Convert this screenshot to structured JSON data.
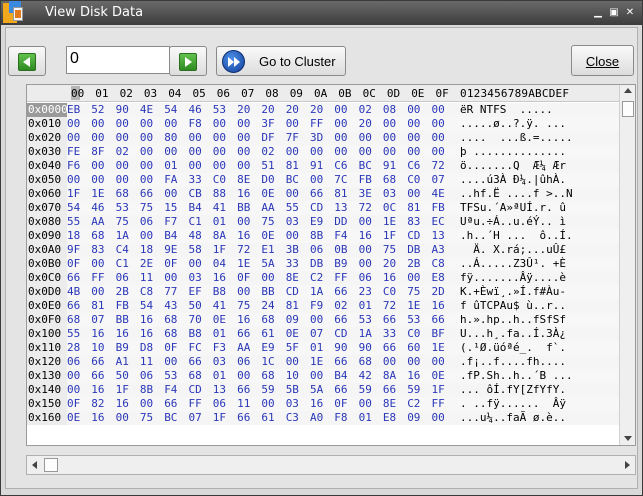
{
  "window": {
    "title": "View Disk Data",
    "icons": [
      "app-icon",
      "minimize-icon",
      "maximize-icon",
      "close-icon"
    ]
  },
  "toolbar": {
    "cluster_value": "0",
    "goto_label": "Go to Cluster",
    "close_label": "Close"
  },
  "hex_view": {
    "columns": [
      "00",
      "01",
      "02",
      "03",
      "04",
      "05",
      "06",
      "07",
      "08",
      "09",
      "0A",
      "0B",
      "0C",
      "0D",
      "0E",
      "0F"
    ],
    "ascii_header": "0123456789ABCDEF",
    "rows": [
      {
        "offset": "0x0000",
        "bytes": [
          "EB",
          "52",
          "90",
          "4E",
          "54",
          "46",
          "53",
          "20",
          "20",
          "20",
          "20",
          "00",
          "02",
          "08",
          "00",
          "00"
        ],
        "ascii": "ëR NTFS  ....."
      },
      {
        "offset": "0x010",
        "bytes": [
          "00",
          "00",
          "00",
          "00",
          "00",
          "F8",
          "00",
          "00",
          "3F",
          "00",
          "FF",
          "00",
          "20",
          "00",
          "00",
          "00"
        ],
        "ascii": ".....ø..?.ÿ. ..."
      },
      {
        "offset": "0x020",
        "bytes": [
          "00",
          "00",
          "00",
          "00",
          "80",
          "00",
          "00",
          "00",
          "DF",
          "7F",
          "3D",
          "00",
          "00",
          "00",
          "00",
          "00"
        ],
        "ascii": "....  ...ß.=....."
      },
      {
        "offset": "0x030",
        "bytes": [
          "FE",
          "8F",
          "02",
          "00",
          "00",
          "00",
          "00",
          "00",
          "02",
          "00",
          "00",
          "00",
          "00",
          "00",
          "00",
          "00"
        ],
        "ascii": "þ .............."
      },
      {
        "offset": "0x040",
        "bytes": [
          "F6",
          "00",
          "00",
          "00",
          "01",
          "00",
          "00",
          "00",
          "51",
          "81",
          "91",
          "C6",
          "BC",
          "91",
          "C6",
          "72"
        ],
        "ascii": "ö.......Q  Æ¼ Ær"
      },
      {
        "offset": "0x050",
        "bytes": [
          "00",
          "00",
          "00",
          "00",
          "FA",
          "33",
          "C0",
          "8E",
          "D0",
          "BC",
          "00",
          "7C",
          "FB",
          "68",
          "C0",
          "07"
        ],
        "ascii": "....ú3À Ð¼.|ûhÀ."
      },
      {
        "offset": "0x060",
        "bytes": [
          "1F",
          "1E",
          "68",
          "66",
          "00",
          "CB",
          "88",
          "16",
          "0E",
          "00",
          "66",
          "81",
          "3E",
          "03",
          "00",
          "4E"
        ],
        "ascii": "..hf.Ë ....f >..N"
      },
      {
        "offset": "0x070",
        "bytes": [
          "54",
          "46",
          "53",
          "75",
          "15",
          "B4",
          "41",
          "BB",
          "AA",
          "55",
          "CD",
          "13",
          "72",
          "0C",
          "81",
          "FB"
        ],
        "ascii": "TFSu.´A»ªUÍ.r. û"
      },
      {
        "offset": "0x080",
        "bytes": [
          "55",
          "AA",
          "75",
          "06",
          "F7",
          "C1",
          "01",
          "00",
          "75",
          "03",
          "E9",
          "DD",
          "00",
          "1E",
          "83",
          "EC"
        ],
        "ascii": "Uªu.÷Á..u.éÝ.. ì"
      },
      {
        "offset": "0x090",
        "bytes": [
          "18",
          "68",
          "1A",
          "00",
          "B4",
          "48",
          "8A",
          "16",
          "0E",
          "00",
          "8B",
          "F4",
          "16",
          "1F",
          "CD",
          "13"
        ],
        "ascii": ".h..´H ...  ô..Í."
      },
      {
        "offset": "0x0A0",
        "bytes": [
          "9F",
          "83",
          "C4",
          "18",
          "9E",
          "58",
          "1F",
          "72",
          "E1",
          "3B",
          "06",
          "0B",
          "00",
          "75",
          "DB",
          "A3"
        ],
        "ascii": "  Ä. X.rá;...uÛ£"
      },
      {
        "offset": "0x0B0",
        "bytes": [
          "0F",
          "00",
          "C1",
          "2E",
          "0F",
          "00",
          "04",
          "1E",
          "5A",
          "33",
          "DB",
          "B9",
          "00",
          "20",
          "2B",
          "C8"
        ],
        "ascii": "..Á.....Z3Û¹. +È"
      },
      {
        "offset": "0x0C0",
        "bytes": [
          "66",
          "FF",
          "06",
          "11",
          "00",
          "03",
          "16",
          "0F",
          "00",
          "8E",
          "C2",
          "FF",
          "06",
          "16",
          "00",
          "E8"
        ],
        "ascii": "fÿ.......Âÿ....è"
      },
      {
        "offset": "0x0D0",
        "bytes": [
          "4B",
          "00",
          "2B",
          "C8",
          "77",
          "EF",
          "B8",
          "00",
          "BB",
          "CD",
          "1A",
          "66",
          "23",
          "C0",
          "75",
          "2D"
        ],
        "ascii": "K.+Èwï¸.»Í.f#Àu-"
      },
      {
        "offset": "0x0E0",
        "bytes": [
          "66",
          "81",
          "FB",
          "54",
          "43",
          "50",
          "41",
          "75",
          "24",
          "81",
          "F9",
          "02",
          "01",
          "72",
          "1E",
          "16"
        ],
        "ascii": "f ûTCPAu$ ù..r.."
      },
      {
        "offset": "0x0F0",
        "bytes": [
          "68",
          "07",
          "BB",
          "16",
          "68",
          "70",
          "0E",
          "16",
          "68",
          "09",
          "00",
          "66",
          "53",
          "66",
          "53",
          "66"
        ],
        "ascii": "h.».hp..h..fSfSf"
      },
      {
        "offset": "0x100",
        "bytes": [
          "55",
          "16",
          "16",
          "16",
          "68",
          "B8",
          "01",
          "66",
          "61",
          "0E",
          "07",
          "CD",
          "1A",
          "33",
          "C0",
          "BF"
        ],
        "ascii": "U...h¸.fa..Í.3À¿"
      },
      {
        "offset": "0x110",
        "bytes": [
          "28",
          "10",
          "B9",
          "D8",
          "0F",
          "FC",
          "F3",
          "AA",
          "E9",
          "5F",
          "01",
          "90",
          "90",
          "66",
          "60",
          "1E"
        ],
        "ascii": "(.¹Ø.üóªé_.  f`."
      },
      {
        "offset": "0x120",
        "bytes": [
          "06",
          "66",
          "A1",
          "11",
          "00",
          "66",
          "03",
          "06",
          "1C",
          "00",
          "1E",
          "66",
          "68",
          "00",
          "00",
          "00"
        ],
        "ascii": ".f¡..f....fh...."
      },
      {
        "offset": "0x130",
        "bytes": [
          "00",
          "66",
          "50",
          "06",
          "53",
          "68",
          "01",
          "00",
          "68",
          "10",
          "00",
          "B4",
          "42",
          "8A",
          "16",
          "0E"
        ],
        "ascii": ".fP.Sh..h..´B ..."
      },
      {
        "offset": "0x140",
        "bytes": [
          "00",
          "16",
          "1F",
          "8B",
          "F4",
          "CD",
          "13",
          "66",
          "59",
          "5B",
          "5A",
          "66",
          "59",
          "66",
          "59",
          "1F"
        ],
        "ascii": "... ôÍ.fY[ZfYfY."
      },
      {
        "offset": "0x150",
        "bytes": [
          "0F",
          "82",
          "16",
          "00",
          "66",
          "FF",
          "06",
          "11",
          "00",
          "03",
          "16",
          "0F",
          "00",
          "8E",
          "C2",
          "FF"
        ],
        "ascii": ". ..fÿ......  Âÿ"
      },
      {
        "offset": "0x160",
        "bytes": [
          "0E",
          "16",
          "00",
          "75",
          "BC",
          "07",
          "1F",
          "66",
          "61",
          "C3",
          "A0",
          "F8",
          "01",
          "E8",
          "09",
          "00"
        ],
        "ascii": "...u¼..faÃ ø.è.."
      }
    ]
  }
}
